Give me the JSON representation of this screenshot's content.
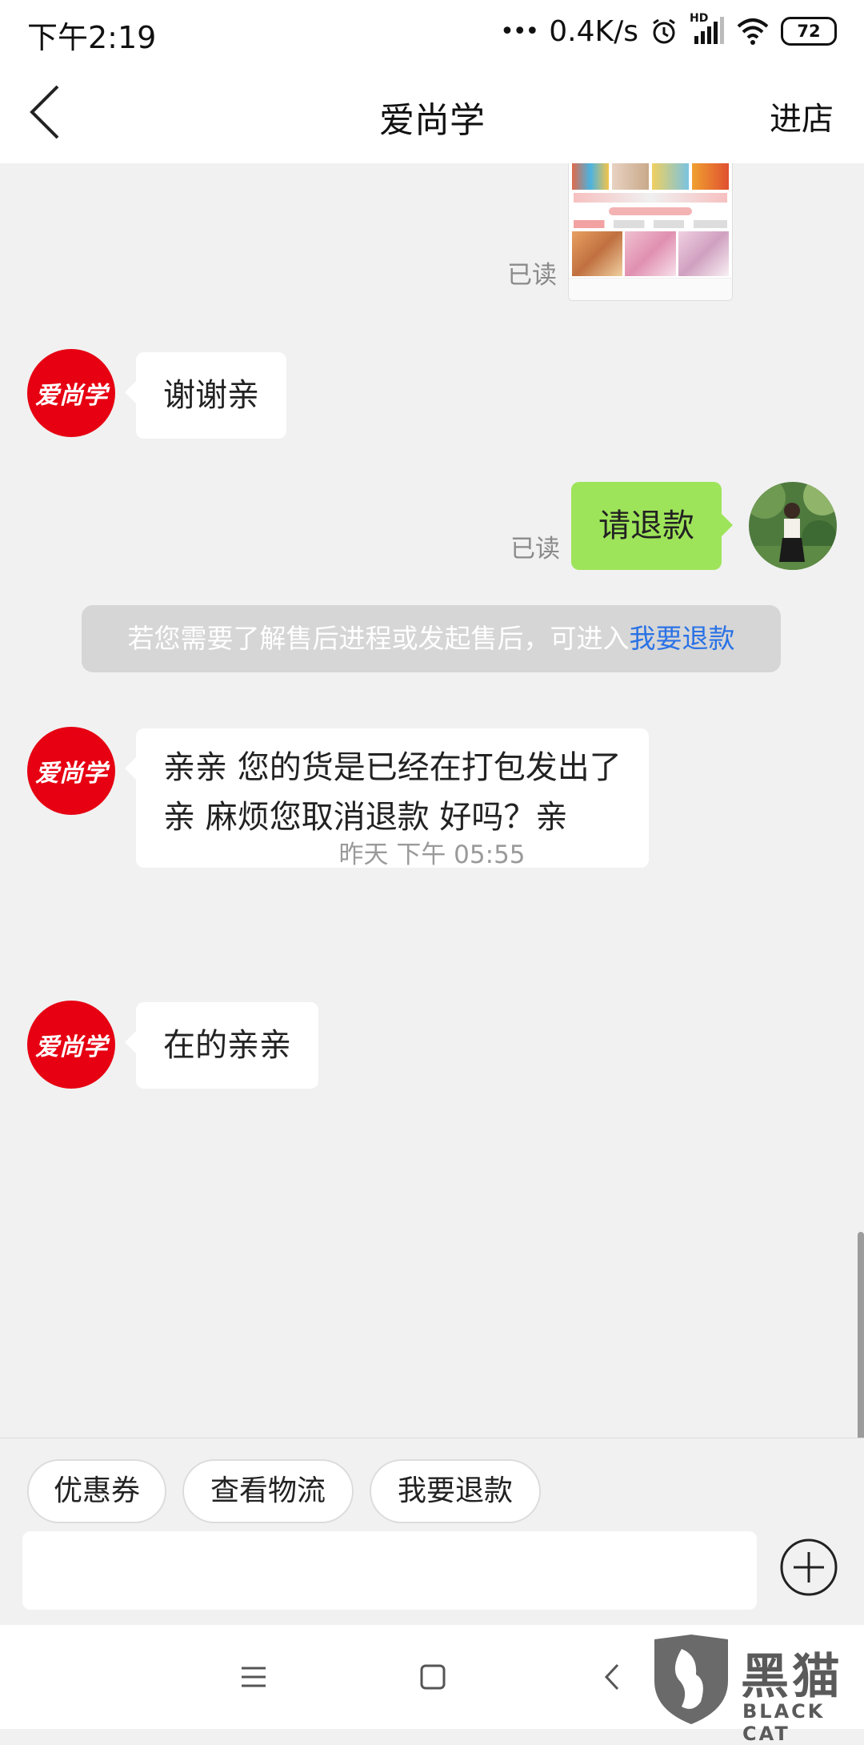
{
  "status_bar": {
    "time": "下午2:19",
    "network_speed": "0.4K/s",
    "signal_label": "HD",
    "battery": "72"
  },
  "header": {
    "title": "爱尚学",
    "right_action": "进店"
  },
  "shop": {
    "avatar_text": "爱尚学",
    "brand_color": "#e60012"
  },
  "messages": {
    "read_label_1": "已读",
    "shop_msg_1": "谢谢亲",
    "user_msg_1": "请退款",
    "read_label_2": "已读",
    "system_tip_text": "若您需要了解售后进程或发起售后，可进入",
    "system_tip_link": "我要退款",
    "shop_msg_2_line1": "亲亲  您的货是已经在打包发出了",
    "shop_msg_2_line2": "亲  麻烦您取消退款  好吗？亲",
    "time_separator": "昨天 下午 05:55",
    "shop_msg_3": "在的亲亲"
  },
  "quick_actions": [
    "优惠券",
    "查看物流",
    "我要退款"
  ],
  "watermark": {
    "text": "黑猫",
    "sub": "BLACK CAT"
  },
  "colors": {
    "outgoing_bubble": "#9ee45a",
    "link": "#2a72e6"
  }
}
